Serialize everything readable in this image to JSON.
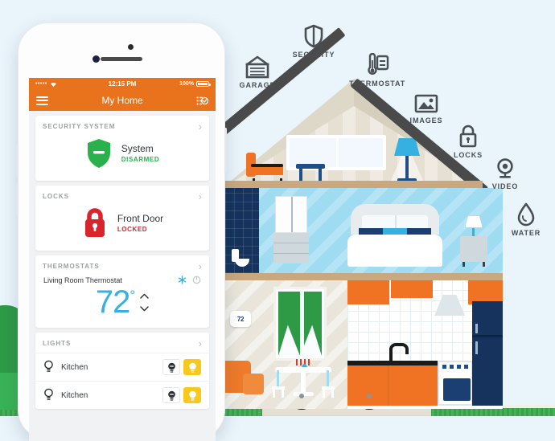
{
  "phone": {
    "status_bar": {
      "signal_dots": "•••••",
      "carrier_icon": "wifi-icon",
      "time": "12:15 PM",
      "battery_percent": "100%"
    },
    "nav": {
      "menu_icon": "hamburger-menu-icon",
      "title": "My Home",
      "right_icon": "checklist-icon"
    },
    "sections": [
      {
        "id": "security-system",
        "title": "SECURITY SYSTEM",
        "chevron": "›",
        "icon": "shield-minus-icon",
        "item_name": "System",
        "item_state": "DISARMED",
        "state_color": "#2bb14c"
      },
      {
        "id": "locks",
        "title": "LOCKS",
        "chevron": "›",
        "icon": "padlock-icon",
        "item_name": "Front Door",
        "item_state": "LOCKED",
        "state_color": "#d8242c"
      },
      {
        "id": "thermostats",
        "title": "THERMOSTATS",
        "chevron": "›",
        "device_name": "Living Room Thermostat",
        "mode_icons": [
          "snowflake-icon",
          "power-icon"
        ],
        "temperature": "72",
        "degree_symbol": "°",
        "up_arrow": "⌃",
        "down_arrow": "⌄"
      },
      {
        "id": "lights",
        "title": "LIGHTS",
        "chevron": "›",
        "rows": [
          {
            "name": "Kitchen",
            "off_label": "bulb-off-icon",
            "on_label": "bulb-on-icon"
          },
          {
            "name": "Kitchen",
            "off_label": "bulb-off-icon",
            "on_label": "bulb-on-icon"
          }
        ]
      }
    ]
  },
  "features": [
    {
      "id": "garage",
      "label": "GARAGE",
      "icon": "garage-door-icon"
    },
    {
      "id": "security",
      "label": "SECURITY",
      "icon": "shield-icon"
    },
    {
      "id": "thermostat",
      "label": "THERMOSTAT",
      "icon": "thermometer-icon"
    },
    {
      "id": "images",
      "label": "IMAGES",
      "icon": "photo-icon"
    },
    {
      "id": "locks",
      "label": "LOCKS",
      "icon": "padlock-icon"
    },
    {
      "id": "video",
      "label": "VIDEO",
      "icon": "camera-icon"
    },
    {
      "id": "water",
      "label": "WATER",
      "icon": "water-drop-icon"
    }
  ],
  "house": {
    "wall_thermostat_reading": "72"
  },
  "colors": {
    "brand_orange": "#e8731c",
    "sky": "#eaf4fb",
    "accent_blue": "#35b0e0",
    "armed_green": "#2bb14c",
    "locked_red": "#d8242c",
    "light_yellow": "#f7c81e"
  }
}
